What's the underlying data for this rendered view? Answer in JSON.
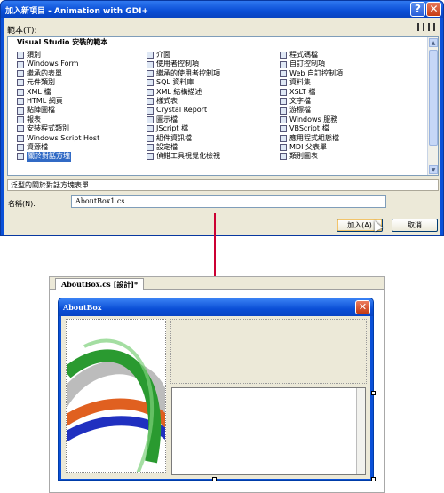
{
  "dialog": {
    "title": "加入新項目 - Animation with GDI+",
    "help_label": "?",
    "close_label": "✕",
    "templates_label": "範本(T):",
    "group_header": "Visual Studio 安裝的範本",
    "items": [
      [
        "類別",
        "Windows Form",
        "繼承的表單",
        "元件類別",
        "XML 檔",
        "HTML 網頁",
        "點陣圖檔",
        "報表",
        "安裝程式類別",
        "Windows Script Host",
        "資源檔",
        "關於對話方塊"
      ],
      [
        "介面",
        "使用者控制項",
        "繼承的使用者控制項",
        "SQL 資料庫",
        "XML 結構描述",
        "樣式表",
        "Crystal Report",
        "圖示檔",
        "JScript 檔",
        "組件資訊檔",
        "設定檔",
        "偵錯工具視覺化檢視"
      ],
      [
        "程式碼檔",
        "自訂控制項",
        "Web 自訂控制項",
        "資料集",
        "XSLT 檔",
        "文字檔",
        "游標檔",
        "Windows 服務",
        "VBScript 檔",
        "應用程式組態檔",
        "MDI 父表單",
        "類別圖表"
      ]
    ],
    "selected_item": "關於對話方塊",
    "description": "泛型的關於對話方塊表單",
    "name_label": "名稱(N):",
    "name_value": "AboutBox1.cs",
    "add_button": "加入(A)",
    "cancel_button": "取消"
  },
  "designer": {
    "tab_label": "AboutBox.cs [設計]*",
    "form_title": "AboutBox",
    "form_close_label": "✕"
  }
}
